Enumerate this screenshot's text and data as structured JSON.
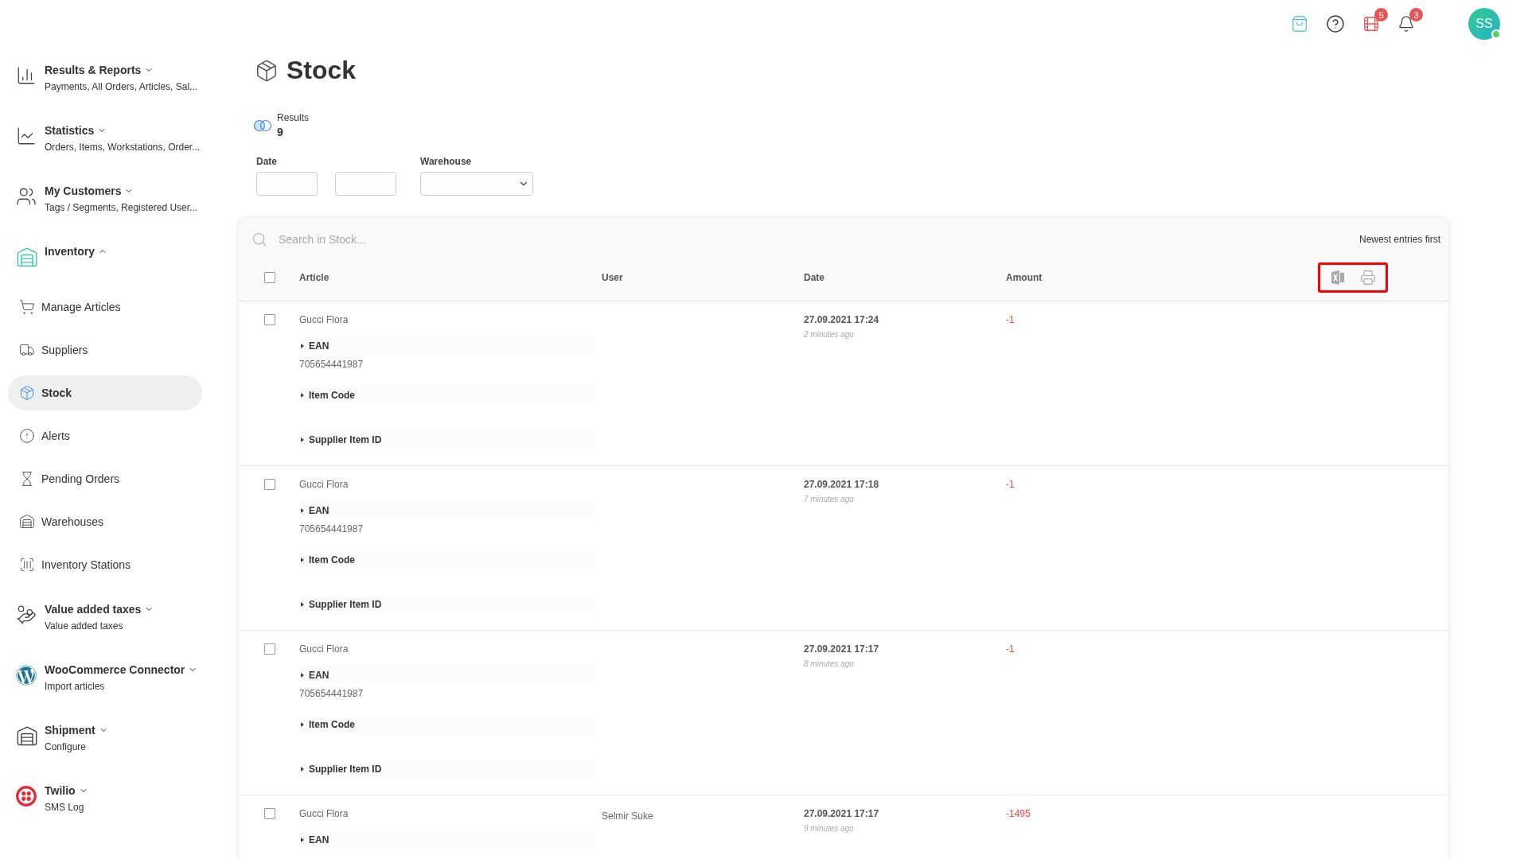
{
  "header": {
    "badges": [
      "5",
      "3"
    ],
    "avatar": {
      "initials": "SS",
      "online": true
    }
  },
  "sidebar": {
    "groups": [
      {
        "title": "Results & Reports",
        "subtitle": "Payments, All Orders, Articles, Sal...",
        "expanded": false
      },
      {
        "title": "Statistics",
        "subtitle": "Orders, Items, Workstations, Order...",
        "expanded": false
      },
      {
        "title": "My Customers",
        "subtitle": "Tags / Segments, Registered User...",
        "expanded": false
      },
      {
        "title": "Inventory",
        "expanded": true,
        "children": [
          {
            "label": "Manage Articles",
            "selected": false
          },
          {
            "label": "Suppliers",
            "selected": false
          },
          {
            "label": "Stock",
            "selected": true
          },
          {
            "label": "Alerts",
            "selected": false
          },
          {
            "label": "Pending Orders",
            "selected": false
          },
          {
            "label": "Warehouses",
            "selected": false
          },
          {
            "label": "Inventory Stations",
            "selected": false
          }
        ]
      },
      {
        "title": "Value added taxes",
        "subtitle": "Value added taxes",
        "expanded": false
      },
      {
        "title": "WooCommerce Connector",
        "subtitle": "Import articles",
        "expanded": false
      },
      {
        "title": "Shipment",
        "subtitle": "Configure",
        "expanded": false
      },
      {
        "title": "Twilio",
        "subtitle": "SMS Log",
        "expanded": false
      }
    ]
  },
  "page": {
    "title": "Stock",
    "results": {
      "label": "Results",
      "count": "9"
    },
    "filters": {
      "date_label": "Date",
      "warehouse_label": "Warehouse"
    }
  },
  "table": {
    "search": {
      "placeholder": "Search in Stock..."
    },
    "sort": "Newest entries first",
    "columns": [
      "Article",
      "User",
      "Date",
      "Amount"
    ],
    "header_checked": false,
    "rows": [
      {
        "checked": false,
        "article": "Gucci Flora",
        "user": "",
        "date": "27.09.2021 17:24",
        "ago": "2 minutes ago",
        "amount": "-1",
        "fields": [
          {
            "label": "EAN",
            "expanded": false,
            "value": "705654441987"
          },
          {
            "label": "Item Code",
            "expanded": false
          },
          {
            "label": "Supplier Item ID",
            "expanded": false
          }
        ]
      },
      {
        "checked": false,
        "article": "Gucci Flora",
        "user": "",
        "date": "27.09.2021 17:18",
        "ago": "7 minutes ago",
        "amount": "-1",
        "fields": [
          {
            "label": "EAN",
            "expanded": false,
            "value": "705654441987"
          },
          {
            "label": "Item Code",
            "expanded": false
          },
          {
            "label": "Supplier Item ID",
            "expanded": false
          }
        ]
      },
      {
        "checked": false,
        "article": "Gucci Flora",
        "user": "",
        "date": "27.09.2021 17:17",
        "ago": "8 minutes ago",
        "amount": "-1",
        "fields": [
          {
            "label": "EAN",
            "expanded": false,
            "value": "705654441987"
          },
          {
            "label": "Item Code",
            "expanded": false
          },
          {
            "label": "Supplier Item ID",
            "expanded": false
          }
        ]
      },
      {
        "checked": false,
        "article": "Gucci Flora",
        "user": "Selmir Suke",
        "date": "27.09.2021 17:17",
        "ago": "9 minutes ago",
        "amount": "-1495",
        "fields": [
          {
            "label": "EAN",
            "expanded": false
          }
        ]
      }
    ]
  }
}
